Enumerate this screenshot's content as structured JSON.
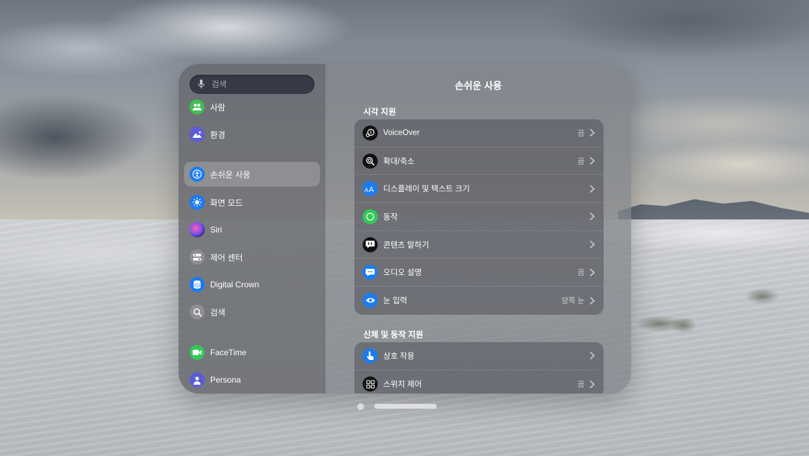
{
  "sidebar": {
    "search_placeholder": "검색",
    "items": [
      {
        "label": "사람",
        "icon": "people-icon",
        "color": "#3fbf52"
      },
      {
        "label": "환경",
        "icon": "environment-icon",
        "color": "#5b5bd6"
      },
      {
        "label": "손쉬운 사용",
        "icon": "accessibility-icon",
        "color": "#1a7cf0",
        "selected": true
      },
      {
        "label": "화면 모드",
        "icon": "display-mode-icon",
        "color": "#1a7cf0"
      },
      {
        "label": "Siri",
        "icon": "siri-icon",
        "color": "#2b2d42"
      },
      {
        "label": "제어 센터",
        "icon": "control-center-icon",
        "color": "#8e8e93"
      },
      {
        "label": "Digital Crown",
        "icon": "digital-crown-icon",
        "color": "#1a7cf0"
      },
      {
        "label": "검색",
        "icon": "search-icon",
        "color": "#8e8e93"
      },
      {
        "label": "FaceTime",
        "icon": "facetime-icon",
        "color": "#34c759"
      },
      {
        "label": "Persona",
        "icon": "persona-icon",
        "color": "#5b5bd6"
      }
    ]
  },
  "main": {
    "title": "손쉬운 사용",
    "sections": [
      {
        "title": "시각 지원",
        "rows": [
          {
            "label": "VoiceOver",
            "value": "끔",
            "icon": "voiceover-icon",
            "color": "#111111"
          },
          {
            "label": "확대/축소",
            "value": "끔",
            "icon": "zoom-icon",
            "color": "#111111"
          },
          {
            "label": "디스플레이 및 텍스트 크기",
            "value": "",
            "icon": "text-size-icon",
            "color": "#1a7cf0"
          },
          {
            "label": "동작",
            "value": "",
            "icon": "motion-icon",
            "color": "#34c759"
          },
          {
            "label": "콘텐츠 말하기",
            "value": "",
            "icon": "speak-content-icon",
            "color": "#111111"
          },
          {
            "label": "오디오 설명",
            "value": "끔",
            "icon": "audio-description-icon",
            "color": "#1a7cf0"
          },
          {
            "label": "눈 입력",
            "value": "양쪽 눈",
            "icon": "eye-input-icon",
            "color": "#1a7cf0"
          }
        ]
      },
      {
        "title": "신체 및 동작 지원",
        "rows": [
          {
            "label": "상호 작용",
            "value": "",
            "icon": "interaction-icon",
            "color": "#1a7cf0"
          },
          {
            "label": "스위치 제어",
            "value": "끔",
            "icon": "switch-control-icon",
            "color": "#111111"
          }
        ]
      }
    ]
  }
}
